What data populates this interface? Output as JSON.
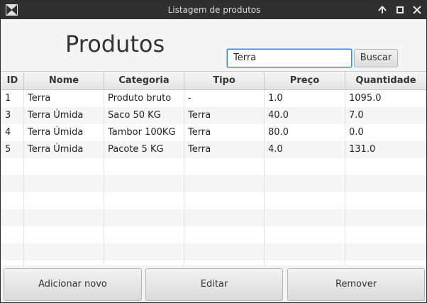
{
  "window": {
    "title": "Listagem de produtos"
  },
  "page": {
    "heading": "Produtos"
  },
  "search": {
    "value": "Terra",
    "button_label": "Buscar"
  },
  "table": {
    "columns": [
      "ID",
      "Nome",
      "Categoria",
      "Tipo",
      "Preço",
      "Quantidade"
    ],
    "rows": [
      [
        "1",
        "Terra",
        "Produto bruto",
        "-",
        "1.0",
        "1095.0"
      ],
      [
        "3",
        "Terra Úmida",
        "Saco 50 KG",
        "Terra",
        "40.0",
        "7.0"
      ],
      [
        "4",
        "Terra Úmida",
        "Tambor 100KG",
        "Terra",
        "80.0",
        "0.0"
      ],
      [
        "5",
        "Terra Úmida",
        "Pacote 5 KG",
        "Terra",
        "4.0",
        "131.0"
      ]
    ]
  },
  "actions": {
    "add_label": "Adicionar novo",
    "edit_label": "Editar",
    "remove_label": "Remover"
  },
  "icons": {
    "app": "app-logo-icon",
    "maximize": "arrow-up-icon",
    "restore": "square-icon",
    "close": "close-icon"
  }
}
